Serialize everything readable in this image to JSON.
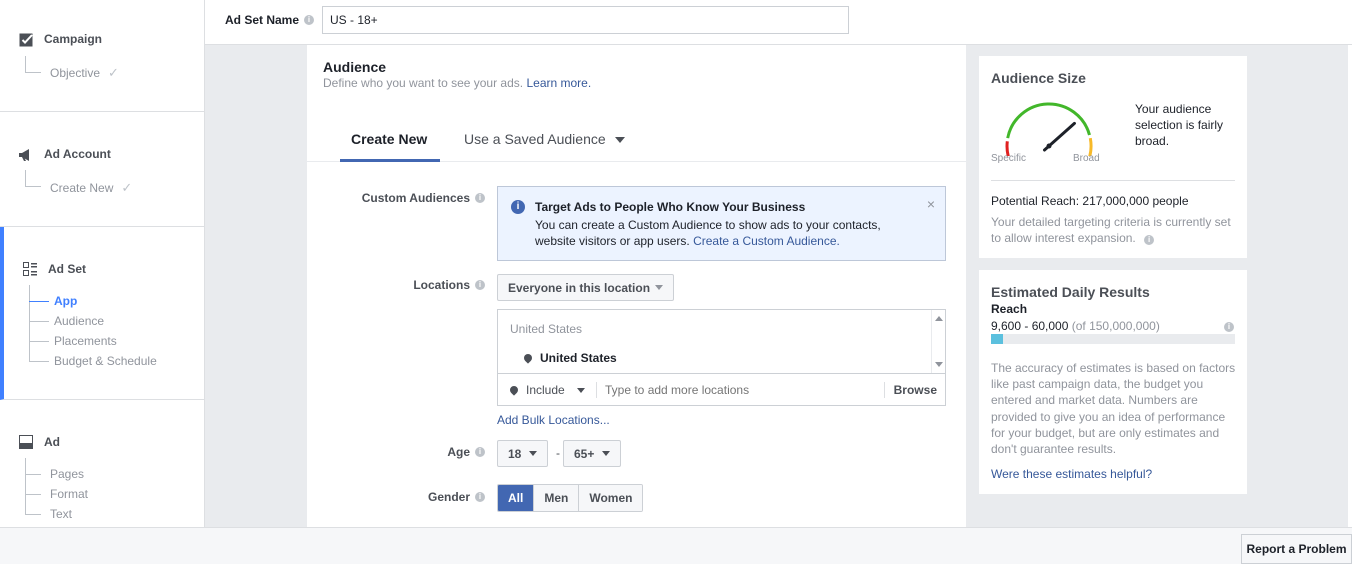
{
  "sidebar": {
    "campaign": {
      "title": "Campaign",
      "items": [
        {
          "label": "Objective",
          "done": true
        }
      ]
    },
    "ad_account": {
      "title": "Ad Account",
      "items": [
        {
          "label": "Create New",
          "done": true
        }
      ]
    },
    "ad_set": {
      "title": "Ad Set",
      "items": [
        {
          "label": "App",
          "current": true
        },
        {
          "label": "Audience"
        },
        {
          "label": "Placements"
        },
        {
          "label": "Budget & Schedule"
        }
      ]
    },
    "ad": {
      "title": "Ad",
      "items": [
        {
          "label": "Pages"
        },
        {
          "label": "Format"
        },
        {
          "label": "Text"
        }
      ]
    },
    "check_glyph": "✓"
  },
  "topbar": {
    "label": "Ad Set Name",
    "info": "i",
    "value": "US - 18+"
  },
  "audience": {
    "title": "Audience",
    "description": "Define who you want to see your ads.",
    "learn_more": "Learn more.",
    "tabs": {
      "create_new": "Create New",
      "saved": "Use a Saved Audience"
    },
    "custom_audiences": {
      "label": "Custom Audiences",
      "notice_title": "Target Ads to People Who Know Your Business",
      "notice_body": "You can create a Custom Audience to show ads to your contacts, website visitors or app users.",
      "notice_link": "Create a Custom Audience.",
      "close": "×",
      "info": "i"
    },
    "locations": {
      "label": "Locations",
      "dropdown": "Everyone in this location",
      "country": "United States",
      "selected": "United States",
      "include": "Include",
      "placeholder": "Type to add more locations",
      "browse": "Browse",
      "bulk_link": "Add Bulk Locations..."
    },
    "age": {
      "label": "Age",
      "min": "18",
      "dash": "-",
      "max": "65+"
    },
    "gender": {
      "label": "Gender",
      "options": [
        "All",
        "Men",
        "Women"
      ],
      "selected": "All"
    }
  },
  "audience_size": {
    "title": "Audience Size",
    "summary": "Your audience selection is fairly broad.",
    "specific": "Specific",
    "broad": "Broad",
    "gauge_level": 0.72,
    "potential_reach": "Potential Reach: 217,000,000 people",
    "note": "Your detailed targeting criteria is currently set to allow interest expansion.",
    "info": "i",
    "colors": {
      "red": "#e02020",
      "green": "#42b72a",
      "orange": "#f7b928",
      "needle": "#1d2129"
    }
  },
  "estimated": {
    "title": "Estimated Daily Results",
    "reach_label": "Reach",
    "range": "9,600 - 60,000",
    "of_total": "(of 150,000,000)",
    "bar_fraction": 0.05,
    "bar_color": "#5bc0de",
    "info": "i",
    "note": "The accuracy of estimates is based on factors like past campaign data, the budget you entered and market data. Numbers are provided to give you an idea of performance for your budget, but are only estimates and don't guarantee results.",
    "feedback_link": "Were these estimates helpful?"
  },
  "report_button": "Report a Problem"
}
